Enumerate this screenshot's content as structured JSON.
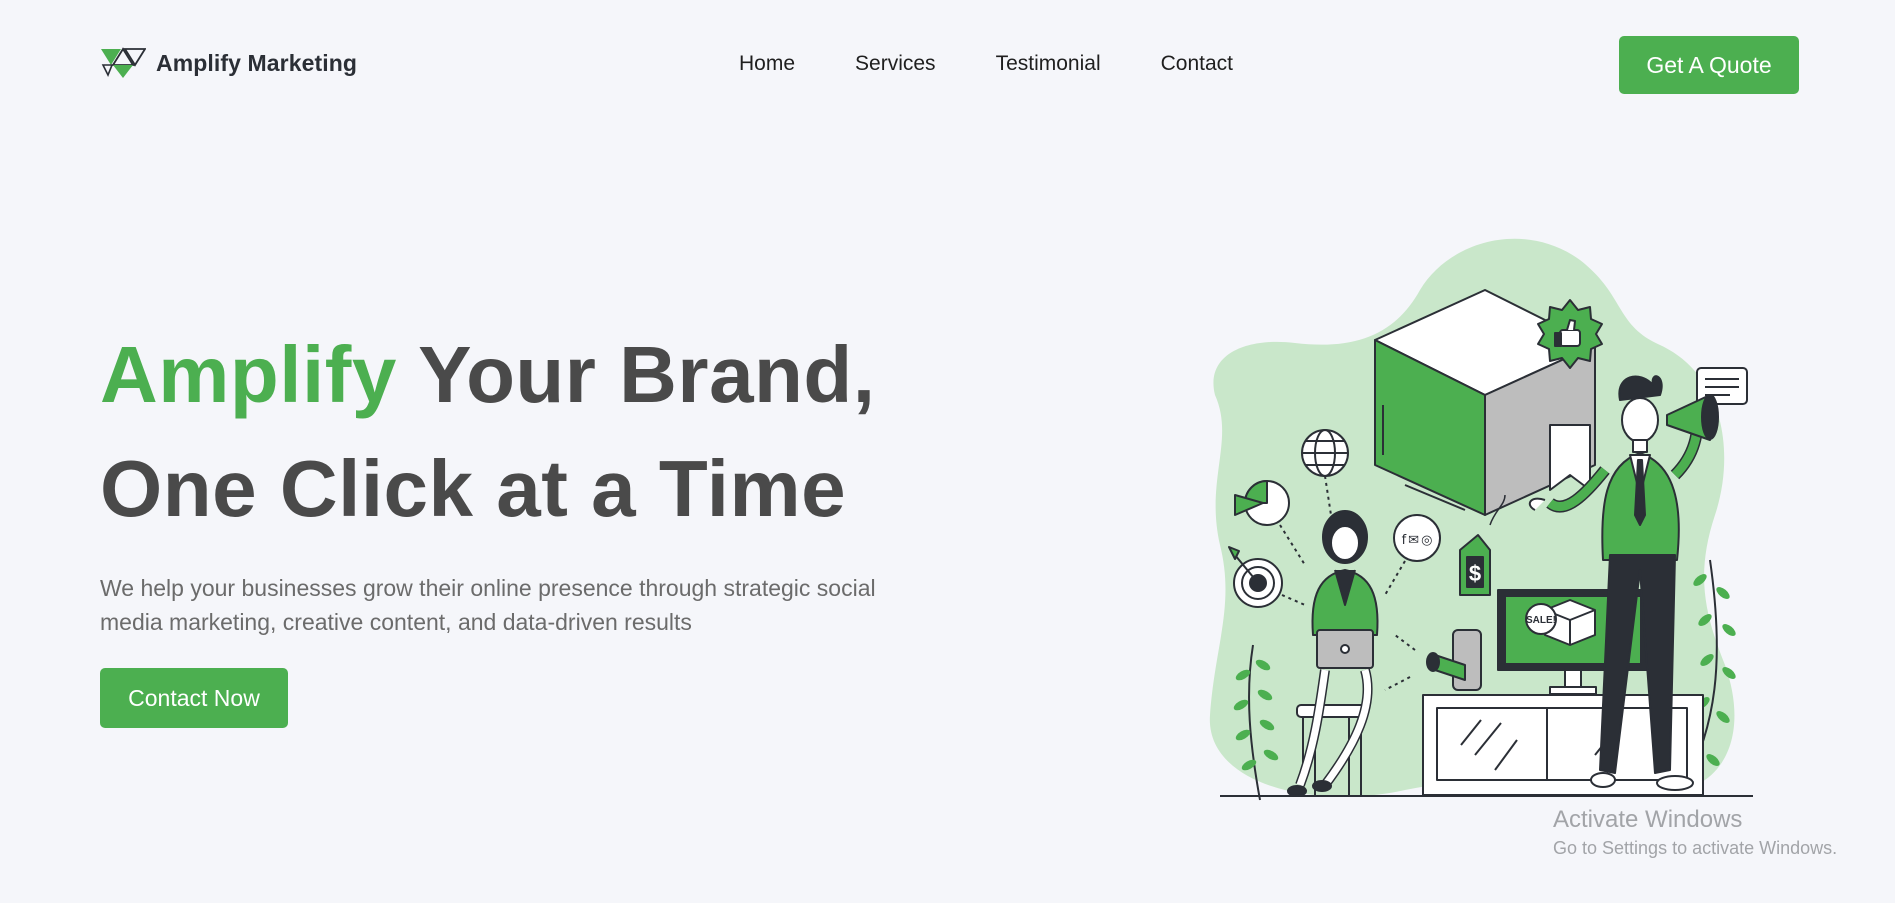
{
  "header": {
    "brand_name": "Amplify Marketing",
    "logo_icon": "triangle-logo-icon",
    "nav": [
      "Home",
      "Services",
      "Testimonial",
      "Contact"
    ],
    "cta_label": "Get A Quote"
  },
  "hero": {
    "title_accent": "Amplify",
    "title_rest_line1": " Your Brand,",
    "title_line2": "One Click at a Time",
    "subtitle": "We help your businesses grow their online presence through strategic social media marketing, creative content, and data-driven results",
    "button_label": "Contact Now"
  },
  "illustration": {
    "tag_symbol": "$",
    "monitor_badge": "SALE!",
    "social_icons": [
      "f",
      "✉",
      "◎"
    ]
  },
  "overlay": {
    "activate_title": "Activate Windows",
    "activate_sub": "Go to Settings to activate Windows."
  },
  "colors": {
    "accent": "#4caf50",
    "accent_light": "#c9e7ca",
    "text_dark": "#4a4a4a",
    "background": "#f5f6fa"
  }
}
